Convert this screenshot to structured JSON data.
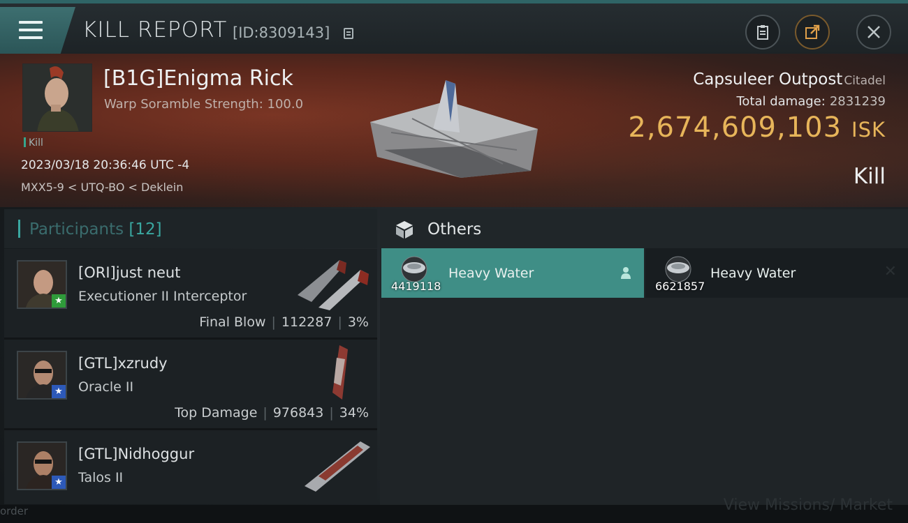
{
  "header": {
    "title": "KILL REPORT",
    "report_id": "[ID:8309143]"
  },
  "victim": {
    "name": "[B1G]Enigma Rick",
    "subtitle": "Warp Soramble Strength: 100.0",
    "tag": "Kill",
    "datetime": "2023/03/18 20:36:46 UTC -4",
    "location": "MXX5-9 < UTQ-BO < Deklein",
    "ship_type": "Capsuleer Outpost",
    "ship_class": "Citadel",
    "total_damage_label": "Total damage:",
    "total_damage": "2831239",
    "isk_value": "2,674,609,103",
    "isk_unit": "ISK",
    "result": "Kill"
  },
  "participants": {
    "label": "Participants",
    "count": "[12]",
    "items": [
      {
        "name": "[ORI]just neut",
        "ship": "Executioner II Interceptor",
        "role": "Final Blow",
        "damage": "112287",
        "percent": "3%",
        "badge": "green"
      },
      {
        "name": "[GTL]xzrudy",
        "ship": "Oracle II",
        "role": "Top Damage",
        "damage": "976843",
        "percent": "34%",
        "badge": "blue"
      },
      {
        "name": "[GTL]Nidhoggur",
        "ship": "Talos II",
        "role": "",
        "damage": "",
        "percent": "",
        "badge": "blue"
      }
    ]
  },
  "others": {
    "label": "Others",
    "items": [
      {
        "name": "Heavy Water",
        "quantity": "4419118"
      },
      {
        "name": "Heavy Water",
        "quantity": "6621857"
      }
    ]
  },
  "footer": {
    "left": "order",
    "right": "View Missions/ Market"
  },
  "colors": {
    "accent_teal": "#3aa7a0",
    "isk_gold": "#e7b55a",
    "active_card": "#3f8e86"
  }
}
